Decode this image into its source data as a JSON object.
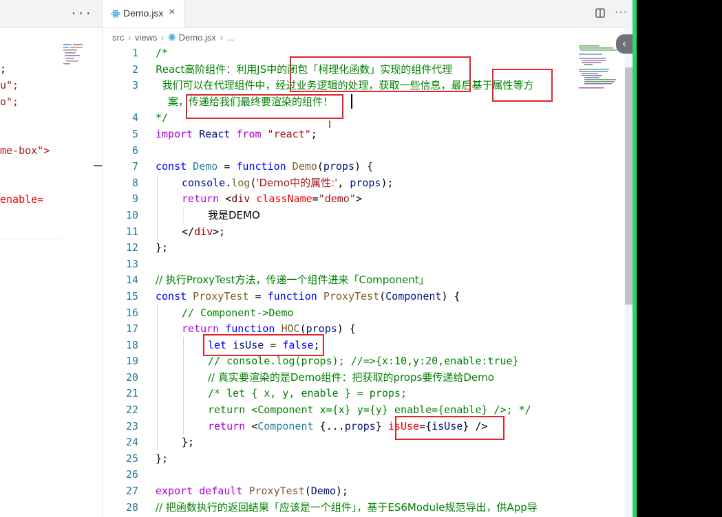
{
  "left_pane": {
    "more_label": "···",
    "lines": [
      ";",
      "u\";",
      "o\";",
      "me-box\">",
      "enable="
    ]
  },
  "editor": {
    "tab_label": "Demo.jsx",
    "close_label": "×",
    "more_label": "···",
    "breadcrumb": [
      "src",
      "views",
      "Demo.jsx",
      "..."
    ],
    "line_numbers": [
      "1",
      "2",
      "3",
      "",
      "4",
      "5",
      "6",
      "7",
      "8",
      "9",
      "10",
      "11",
      "12",
      "13",
      "14",
      "15",
      "16",
      "17",
      "18",
      "19",
      "20",
      "21",
      "22",
      "23",
      "24",
      "25",
      "26",
      "27",
      "28"
    ],
    "code": {
      "l1": "/*",
      "l2": "React高阶组件：利用JS中的闭包「柯理化函数」实现的组件代理",
      "l3": "  我们可以在代理组件中，经过业务逻辑的处理，获取一些信息，最后基于属性等方",
      "l3b": "案，传递给我们最终要渲染的组件！",
      "l4": "*/",
      "l5_kw1": "import",
      "l5_id": " React ",
      "l5_kw2": "from",
      "l5_str": " \"react\"",
      "l5_end": ";",
      "l7_const": "const",
      "l7_name": " Demo",
      "l7_eq": " = ",
      "l7_fn": "function",
      "l7_fname": " Demo",
      "l7_p1": "(",
      "l7_arg": "props",
      "l7_p2": ") {",
      "l8_obj": "console",
      "l8_dot": ".",
      "l8_fn": "log",
      "l8_p1": "(",
      "l8_str": "'Demo中的属性:'",
      "l8_comma": ", ",
      "l8_arg": "props",
      "l8_end": ");",
      "l9_ret": "return",
      "l9_lt": " <",
      "l9_tag": "div",
      "l9_attr": " className",
      "l9_eq": "=",
      "l9_str": "\"demo\"",
      "l9_gt": ">",
      "l10": "我是DEMO",
      "l11_lt": "</",
      "l11_tag": "div",
      "l11_gt": ">;",
      "l12": "};",
      "l14": "// 执行ProxyTest方法，传递一个组件进来「Component」",
      "l15_const": "const",
      "l15_name": " ProxyTest",
      "l15_eq": " = ",
      "l15_fn": "function",
      "l15_fname": " ProxyTest",
      "l15_p1": "(",
      "l15_arg": "Component",
      "l15_p2": ") {",
      "l16": "// Component->Demo",
      "l17_ret": "return",
      "l17_fn": " function",
      "l17_fname": " HOC",
      "l17_p1": "(",
      "l17_arg": "props",
      "l17_p2": ") {",
      "l18_let": "let",
      "l18_name": " isUse",
      "l18_eq": " = ",
      "l18_val": "false",
      "l18_end": ";",
      "l19": "// console.log(props); //=>{x:10,y:20,enable:true}",
      "l20": "// 真实要渲染的是Demo组件：把获取的props要传递给Demo",
      "l21": "/* let { x, y, enable } = props;",
      "l22": "return <Component x={x} y={y} enable={enable} />; */",
      "l23_ret": "return",
      "l23_lt": " <",
      "l23_tag": "Component",
      "l23_mid": " {...",
      "l23_props": "props",
      "l23_close": "} ",
      "l23_attr": "isUse",
      "l23_eq": "={",
      "l23_val": "isUse",
      "l23_end": "} />",
      "l24": "};",
      "l25": "};",
      "l27_exp": "export",
      "l27_def": " default",
      "l27_fn": " ProxyTest",
      "l27_p1": "(",
      "l27_arg": "Demo",
      "l27_p2": ");",
      "l28": "// 把函数执行的返回结果「应该是一个组件」，基于ES6Module规范导出，供App导"
    }
  },
  "colors": {
    "highlight_box": "#e0242b",
    "accent_green": "#2bd66f"
  },
  "icons": [
    "react-icon",
    "close-icon",
    "split-editor-icon",
    "more-icon",
    "chevron-left-icon",
    "text-cursor-icon"
  ]
}
